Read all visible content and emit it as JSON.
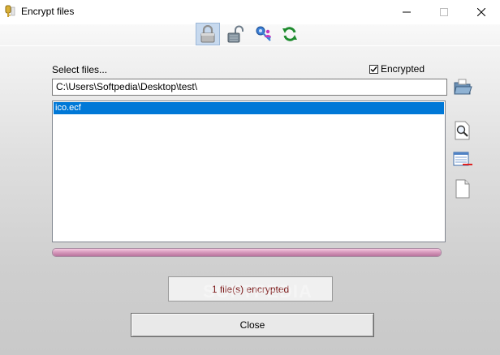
{
  "window": {
    "title": "Encrypt files"
  },
  "toolbar": {
    "items": [
      {
        "icon": "lock-closed-icon",
        "active": true
      },
      {
        "icon": "lock-open-icon",
        "active": false
      },
      {
        "icon": "key-user-icon",
        "active": false
      },
      {
        "icon": "refresh-icon",
        "active": false
      }
    ]
  },
  "form": {
    "select_label": "Select files...",
    "encrypted_label": "Encrypted",
    "encrypted_checked": true,
    "path_value": "C:\\Users\\Softpedia\\Desktop\\test\\"
  },
  "files": [
    "ico.ecf"
  ],
  "progress": {
    "percent": 100
  },
  "status": {
    "text": "1 file(s) encrypted"
  },
  "buttons": {
    "close_label": "Close"
  },
  "watermark": "SOFTPEDIA",
  "colors": {
    "selection": "#0078d7",
    "status_text": "#7a1515",
    "progress_fill": "#d89bbe"
  }
}
